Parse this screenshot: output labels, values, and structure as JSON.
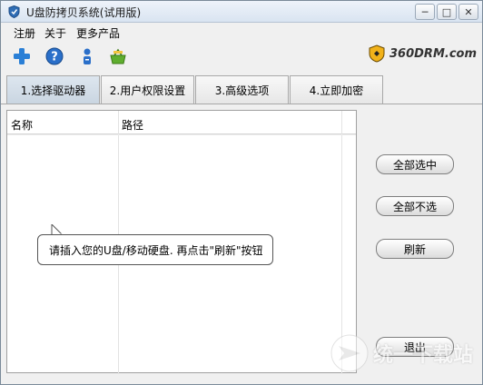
{
  "window": {
    "title": "U盘防拷贝系统(试用版)"
  },
  "menu": {
    "items": [
      "注册",
      "关于",
      "更多产品"
    ]
  },
  "toolbar": {
    "icons": [
      "add-icon",
      "help-icon",
      "user-icon",
      "basket-icon"
    ],
    "brand": "360DRM.com"
  },
  "tabs": [
    {
      "label": "1.选择驱动器",
      "active": true
    },
    {
      "label": "2.用户权限设置",
      "active": false
    },
    {
      "label": "3.高级选项",
      "active": false
    },
    {
      "label": "4.立即加密",
      "active": false
    }
  ],
  "table": {
    "columns": [
      "名称",
      "路径"
    ],
    "rows": []
  },
  "tooltip": "请插入您的U盘/移动硬盘. 再点击\"刷新\"按钮",
  "buttons": {
    "select_all": "全部选中",
    "select_none": "全部不选",
    "refresh": "刷新",
    "exit": "退出"
  },
  "watermark": {
    "text": "统一下载站"
  },
  "colors": {
    "accent_tab": "#cfd9e4",
    "border": "#a0a0a0"
  }
}
